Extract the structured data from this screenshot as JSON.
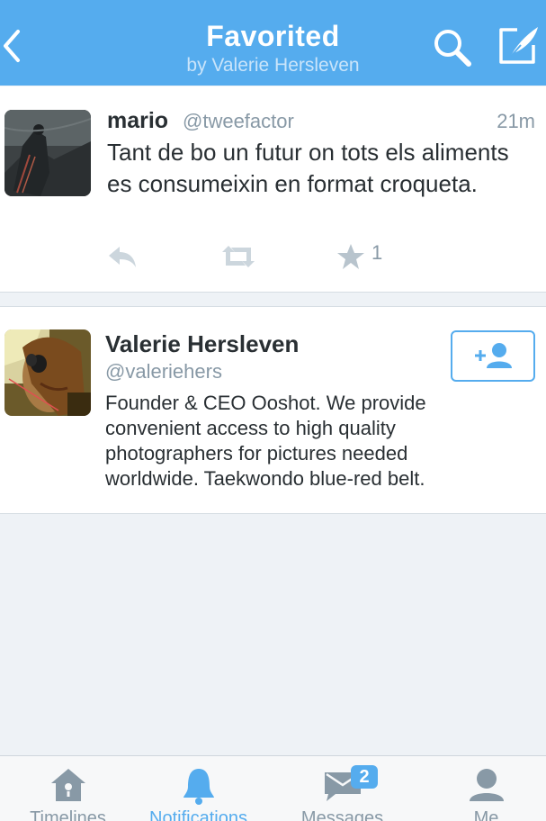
{
  "header": {
    "title": "Favorited",
    "subtitle": "by Valerie Hersleven",
    "back_icon": "chevron-left-icon",
    "search_icon": "search-icon",
    "compose_icon": "compose-icon"
  },
  "tweet": {
    "name": "mario",
    "handle": "@tweefactor",
    "time": "21m",
    "text": "Tant de bo un futur on tots els aliments es consumeixin en format croqueta.",
    "favorite_count": "1"
  },
  "profile": {
    "name": "Valerie Hersleven",
    "handle": "@valeriehers",
    "bio": "Founder & CEO Ooshot. We provide convenient access to high quality photographers for pictures needed worldwide. Taekwondo blue-red belt."
  },
  "tabbar": {
    "tabs": [
      {
        "label": "Timelines",
        "icon": "home-icon"
      },
      {
        "label": "Notifications",
        "icon": "bell-icon",
        "active": true
      },
      {
        "label": "Messages",
        "icon": "envelope-icon"
      },
      {
        "label": "Me",
        "icon": "person-icon"
      }
    ],
    "messages_badge": "2"
  },
  "colors": {
    "brand": "#55acee",
    "background": "#eef2f6",
    "muted_text": "#8899a6",
    "body_text": "#292f33"
  }
}
